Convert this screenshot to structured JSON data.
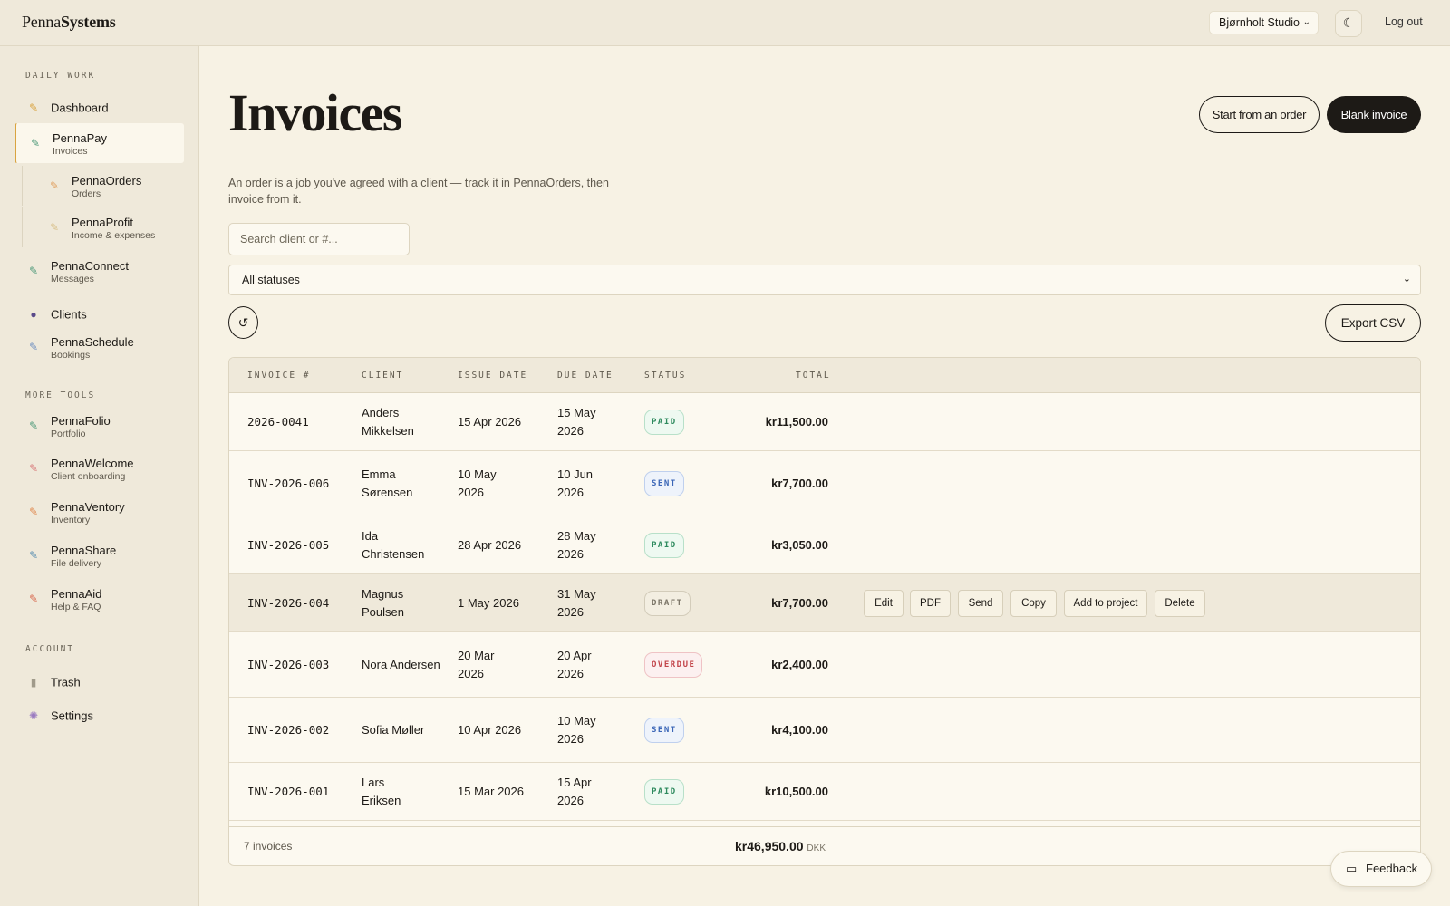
{
  "app": {
    "logo_regular": "Penna",
    "logo_bold": "Systems"
  },
  "topbar": {
    "workspace": "Bjørnholt Studio",
    "theme_icon": "moon-icon",
    "logout": "Log out"
  },
  "sidebar": {
    "daily_label": "DAILY WORK",
    "more_label": "MORE TOOLS",
    "account_label": "ACCOUNT",
    "items": [
      {
        "title": "Dashboard",
        "sub": "",
        "icon": "feather-icon",
        "color": "#d9a441"
      },
      {
        "title": "PennaPay",
        "sub": "Invoices",
        "icon": "feather-icon",
        "color": "#4f9a7a"
      },
      {
        "title": "PennaOrders",
        "sub": "Orders",
        "icon": "feather-icon",
        "color": "#e0a060"
      },
      {
        "title": "PennaProfit",
        "sub": "Income & expenses",
        "icon": "feather-icon",
        "color": "#d8c08a"
      },
      {
        "title": "PennaConnect",
        "sub": "Messages",
        "icon": "feather-icon",
        "color": "#4f9a7a"
      },
      {
        "title": "Clients",
        "sub": "",
        "icon": "users-icon",
        "color": "#5a4a8a"
      },
      {
        "title": "PennaSchedule",
        "sub": "Bookings",
        "icon": "feather-icon",
        "color": "#6f8fc0"
      },
      {
        "title": "PennaFolio",
        "sub": "Portfolio",
        "icon": "feather-icon",
        "color": "#4f9a7a"
      },
      {
        "title": "PennaWelcome",
        "sub": "Client onboarding",
        "icon": "feather-icon",
        "color": "#d87a7a"
      },
      {
        "title": "PennaVentory",
        "sub": "Inventory",
        "icon": "feather-icon",
        "color": "#e08a50"
      },
      {
        "title": "PennaShare",
        "sub": "File delivery",
        "icon": "feather-icon",
        "color": "#5a8fb0"
      },
      {
        "title": "PennaAid",
        "sub": "Help & FAQ",
        "icon": "feather-icon",
        "color": "#d86a50"
      },
      {
        "title": "Trash",
        "sub": "",
        "icon": "trash-icon",
        "color": "#a09a8a"
      },
      {
        "title": "Settings",
        "sub": "",
        "icon": "gear-icon",
        "color": "#9a7ac0"
      }
    ]
  },
  "main": {
    "title": "Invoices",
    "start_from_order": "Start from an order",
    "blank_invoice": "Blank invoice",
    "description": "An order is a job you've agreed with a client — track it in PennaOrders, then invoice from it.",
    "search_placeholder": "Search client or #...",
    "status_filter": "All statuses",
    "refresh_icon": "refresh-icon",
    "export": "Export CSV"
  },
  "table": {
    "headers": [
      "INVOICE #",
      "CLIENT",
      "ISSUE DATE",
      "DUE DATE",
      "STATUS",
      "TOTAL"
    ],
    "rows": [
      {
        "num": "2026-0041",
        "client": "Anders Mikkelsen",
        "issue": "15 Apr 2026",
        "due": "15 May 2026",
        "status": "PAID",
        "total": "kr11,500.00"
      },
      {
        "num": "INV-2026-006",
        "client": "Emma Sørensen",
        "issue": "10 May 2026",
        "due": "10 Jun 2026",
        "status": "SENT",
        "total": "kr7,700.00"
      },
      {
        "num": "INV-2026-005",
        "client": "Ida Christensen",
        "issue": "28 Apr 2026",
        "due": "28 May 2026",
        "status": "PAID",
        "total": "kr3,050.00"
      },
      {
        "num": "INV-2026-004",
        "client": "Magnus Poulsen",
        "issue": "1 May 2026",
        "due": "31 May 2026",
        "status": "DRAFT",
        "total": "kr7,700.00"
      },
      {
        "num": "INV-2026-003",
        "client": "Nora Andersen",
        "issue": "20 Mar 2026",
        "due": "20 Apr 2026",
        "status": "OVERDUE",
        "total": "kr2,400.00"
      },
      {
        "num": "INV-2026-002",
        "client": "Sofia Møller",
        "issue": "10 Apr 2026",
        "due": "10 May 2026",
        "status": "SENT",
        "total": "kr4,100.00"
      },
      {
        "num": "INV-2026-001",
        "client": "Lars Eriksen",
        "issue": "15 Mar 2026",
        "due": "15 Apr 2026",
        "status": "PAID",
        "total": "kr10,500.00"
      }
    ],
    "row_actions": [
      "Edit",
      "PDF",
      "Send",
      "Copy",
      "Add to project",
      "Delete"
    ],
    "count": "7 invoices",
    "grand_total": "kr46,950.00",
    "currency": "DKK"
  },
  "feedback": "Feedback"
}
